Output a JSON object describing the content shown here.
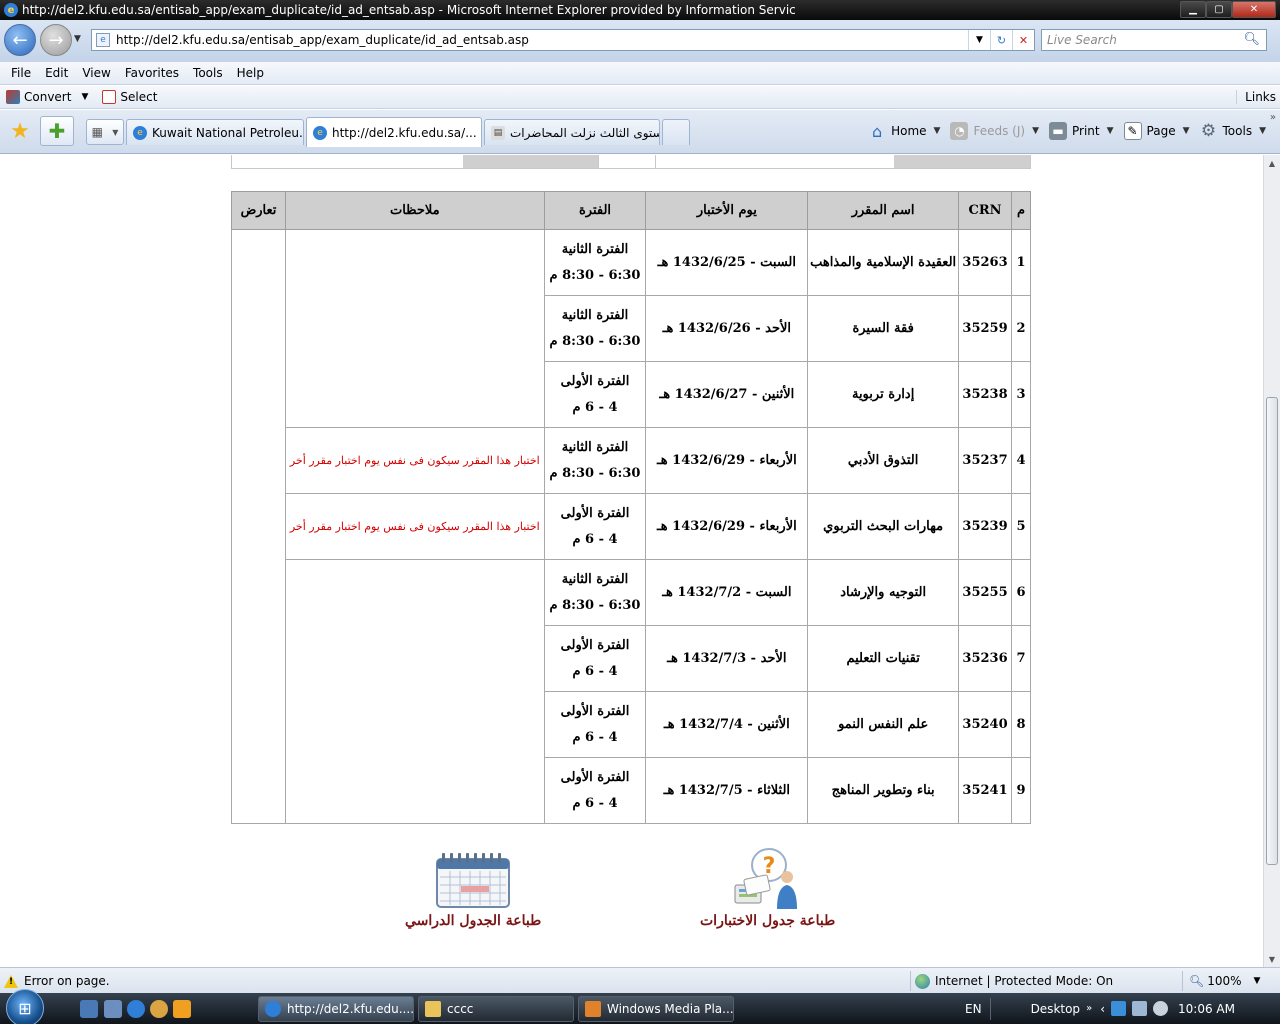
{
  "window": {
    "title": "http://del2.kfu.edu.sa/entisab_app/exam_duplicate/id_ad_entsab.asp - Microsoft Internet Explorer provided by Information Servic"
  },
  "address": {
    "url": "http://del2.kfu.edu.sa/entisab_app/exam_duplicate/id_ad_entsab.asp",
    "search_placeholder": "Live Search"
  },
  "menu": [
    "File",
    "Edit",
    "View",
    "Favorites",
    "Tools",
    "Help"
  ],
  "convert_bar": {
    "convert": "Convert",
    "select": "Select",
    "links": "Links"
  },
  "tabs": [
    {
      "label": "Kuwait National Petroleu..."
    },
    {
      "label": "http://del2.kfu.edu.sa/..."
    },
    {
      "label": "المستوى الثالث نزلت المحاضرات"
    }
  ],
  "commands": {
    "home": "Home",
    "feeds": "Feeds (J)",
    "print": "Print",
    "page": "Page",
    "tools": "Tools"
  },
  "table": {
    "headers": {
      "num": "م",
      "crn": "CRN",
      "course": "اسم المقرر",
      "day": "يوم الأختبار",
      "period": "الفترة",
      "notes": "ملاحظات",
      "conflict": "تعارض"
    },
    "rows": [
      {
        "num": "1",
        "crn": "35263",
        "course": "العقيدة الإسلامية والمذاهب",
        "day": "السبت - 1432/6/25 هـ",
        "period_name": "الفترة الثانية",
        "period_time": "6:30 - 8:30 م",
        "note": ""
      },
      {
        "num": "2",
        "crn": "35259",
        "course": "فقة السيرة",
        "day": "الأحد - 1432/6/26 هـ",
        "period_name": "الفترة الثانية",
        "period_time": "6:30 - 8:30 م",
        "note": ""
      },
      {
        "num": "3",
        "crn": "35238",
        "course": "إدارة تربوية",
        "day": "الأثنين - 1432/6/27 هـ",
        "period_name": "الفترة الأولى",
        "period_time": "4 - 6 م",
        "note": ""
      },
      {
        "num": "4",
        "crn": "35237",
        "course": "التذوق الأدبي",
        "day": "الأربعاء - 1432/6/29 هـ",
        "period_name": "الفترة الثانية",
        "period_time": "6:30 - 8:30 م",
        "note": "اختبار هذا المقرر سيكون فى نفس يوم اختبار مقرر أخر"
      },
      {
        "num": "5",
        "crn": "35239",
        "course": "مهارات البحث التربوي",
        "day": "الأربعاء - 1432/6/29 هـ",
        "period_name": "الفترة الأولى",
        "period_time": "4 - 6 م",
        "note": "اختبار هذا المقرر سيكون فى نفس يوم اختبار مقرر أخر"
      },
      {
        "num": "6",
        "crn": "35255",
        "course": "التوجيه والإرشاد",
        "day": "السبت - 1432/7/2 هـ",
        "period_name": "الفترة الثانية",
        "period_time": "6:30 - 8:30 م",
        "note": ""
      },
      {
        "num": "7",
        "crn": "35236",
        "course": "تقنيات التعليم",
        "day": "الأحد - 1432/7/3 هـ",
        "period_name": "الفترة الأولى",
        "period_time": "4 - 6 م",
        "note": ""
      },
      {
        "num": "8",
        "crn": "35240",
        "course": "علم النفس النمو",
        "day": "الأثنين - 1432/7/4 هـ",
        "period_name": "الفترة الأولى",
        "period_time": "4 - 6 م",
        "note": ""
      },
      {
        "num": "9",
        "crn": "35241",
        "course": "بناء وتطوير المناهج",
        "day": "الثلاثاء - 1432/7/5 هـ",
        "period_name": "الفترة الأولى",
        "period_time": "4 - 6 م",
        "note": ""
      }
    ]
  },
  "actions": {
    "print_exams": "طباعة جدول الاختبارات",
    "print_schedule": "طباعة الجدول الدراسي"
  },
  "status": {
    "error": "Error on page.",
    "zone": "Internet | Protected Mode: On",
    "zoom": "100%"
  },
  "taskbar": {
    "buttons": [
      "http://del2.kfu.edu....",
      "cccc",
      "Windows Media Pla..."
    ],
    "lang": "EN",
    "desktop": "Desktop",
    "clock": "10:06 AM"
  }
}
